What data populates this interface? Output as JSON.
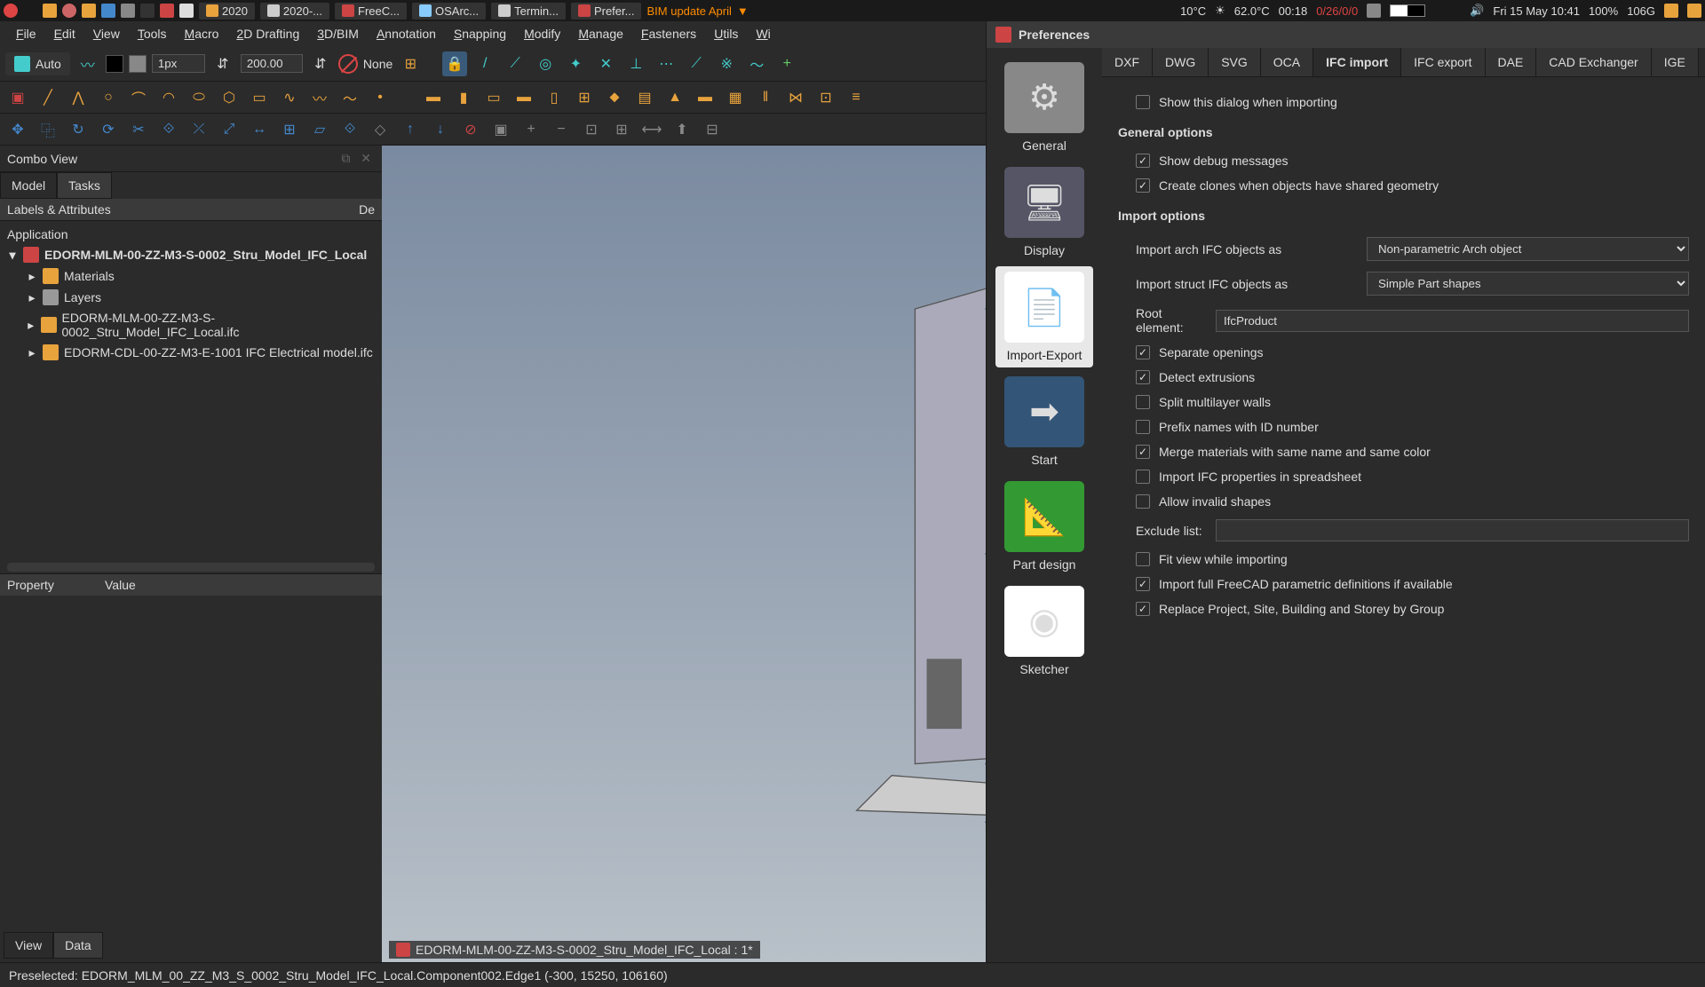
{
  "sysbar": {
    "tasks": [
      {
        "label": "2020",
        "color": "#e8a33d"
      },
      {
        "label": "2020-...",
        "color": "#ccc"
      },
      {
        "label": "FreeC...",
        "color": "#c44"
      },
      {
        "label": "OSArc...",
        "color": "#8cf"
      },
      {
        "label": "Termin...",
        "color": "#ccc"
      },
      {
        "label": "Prefer...",
        "color": "#c44"
      }
    ],
    "bim_text": "BIM update April",
    "temp1": "10°C",
    "temp2": "62.0°C",
    "timer": "00:18",
    "net": "0/26/0/0",
    "date": "Fri 15 May 10:41",
    "battery": "100%",
    "cpu": "106G"
  },
  "menu": [
    "File",
    "Edit",
    "View",
    "Tools",
    "Macro",
    "2D Drafting",
    "3D/BIM",
    "Annotation",
    "Snapping",
    "Modify",
    "Manage",
    "Fasteners",
    "Utils",
    "Wi"
  ],
  "toolbar1": {
    "auto": "Auto",
    "px": "1px",
    "width": "200.00",
    "none": "None"
  },
  "combo_view": {
    "title": "Combo View",
    "tabs": [
      "Model",
      "Tasks"
    ],
    "active_tab": "Model",
    "tree_header_left": "Labels & Attributes",
    "tree_header_right": "De",
    "app_label": "Application",
    "root": "EDORM-MLM-00-ZZ-M3-S-0002_Stru_Model_IFC_Local",
    "children": [
      {
        "icon": "#e8a33d",
        "label": "Materials"
      },
      {
        "icon": "#999",
        "label": "Layers"
      },
      {
        "icon": "#e8a33d",
        "label": "EDORM-MLM-00-ZZ-M3-S-0002_Stru_Model_IFC_Local.ifc"
      },
      {
        "icon": "#e8a33d",
        "label": "EDORM-CDL-00-ZZ-M3-E-1001 IFC Electrical model.ifc"
      }
    ],
    "prop_header_left": "Property",
    "prop_header_right": "Value",
    "view_tabs": [
      "View",
      "Data"
    ]
  },
  "doctab": "EDORM-MLM-00-ZZ-M3-S-0002_Stru_Model_IFC_Local : 1*",
  "status": "Preselected: EDORM_MLM_00_ZZ_M3_S_0002_Stru_Model_IFC_Local.Component002.Edge1 (-300, 15250, 106160)",
  "prefs": {
    "title": "Preferences",
    "categories": [
      {
        "name": "General",
        "icon": "⚙",
        "bg": "#888"
      },
      {
        "name": "Display",
        "icon": "🖥",
        "bg": "#556"
      },
      {
        "name": "Import-Export",
        "icon": "📄",
        "bg": "#fff",
        "selected": true
      },
      {
        "name": "Start",
        "icon": "➡",
        "bg": "#357"
      },
      {
        "name": "Part design",
        "icon": "📐",
        "bg": "#393"
      },
      {
        "name": "Sketcher",
        "icon": "◉",
        "bg": "#fff"
      }
    ],
    "tabs": [
      "DXF",
      "DWG",
      "SVG",
      "OCA",
      "IFC import",
      "IFC export",
      "DAE",
      "CAD Exchanger",
      "IGE"
    ],
    "active_tab": "IFC import",
    "show_dialog": {
      "checked": false,
      "label": "Show this dialog when importing"
    },
    "general_title": "General options",
    "general": [
      {
        "checked": true,
        "label": "Show debug messages"
      },
      {
        "checked": true,
        "label": "Create clones when objects have shared geometry"
      }
    ],
    "import_title": "Import options",
    "arch_label": "Import arch IFC objects as",
    "arch_value": "Non-parametric Arch object",
    "struct_label": "Import struct IFC objects as",
    "struct_value": "Simple Part shapes",
    "root_label": "Root element:",
    "root_value": "IfcProduct",
    "checks": [
      {
        "checked": true,
        "label": "Separate openings"
      },
      {
        "checked": true,
        "label": "Detect extrusions"
      },
      {
        "checked": false,
        "label": "Split multilayer walls"
      },
      {
        "checked": false,
        "label": "Prefix names with ID number"
      },
      {
        "checked": true,
        "label": "Merge materials with same name and same color"
      },
      {
        "checked": false,
        "label": "Import IFC properties in spreadsheet"
      },
      {
        "checked": false,
        "label": "Allow invalid shapes"
      }
    ],
    "exclude_label": "Exclude list:",
    "exclude_value": "",
    "checks2": [
      {
        "checked": false,
        "label": "Fit view while importing"
      },
      {
        "checked": true,
        "label": "Import full FreeCAD parametric definitions if available"
      },
      {
        "checked": true,
        "label": "Replace Project, Site, Building and Storey by Group"
      }
    ]
  }
}
